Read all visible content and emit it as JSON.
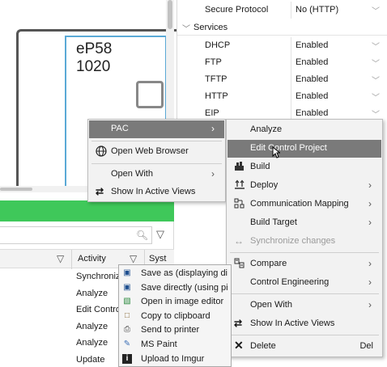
{
  "device": {
    "name": "eP58\n1020"
  },
  "properties": {
    "secure_protocol": {
      "label": "Secure Protocol",
      "value": "No (HTTP)"
    },
    "services_label": "Services",
    "services": [
      {
        "label": "DHCP",
        "value": "Enabled"
      },
      {
        "label": "FTP",
        "value": "Enabled"
      },
      {
        "label": "TFTP",
        "value": "Enabled"
      },
      {
        "label": "HTTP",
        "value": "Enabled"
      },
      {
        "label": "EIP",
        "value": "Enabled"
      }
    ]
  },
  "list": {
    "activity_header": "Activity",
    "system_header": "Syst",
    "activities": [
      "Synchroniz",
      "Analyze",
      "Edit Contro",
      "Analyze",
      "Analyze",
      "Update"
    ]
  },
  "pac_menu": {
    "items": [
      {
        "label": "PAC",
        "submenu": true,
        "highlighted": true
      },
      {
        "label": "Open Web Browser",
        "icon": "globe-icon"
      },
      {
        "label": "Open With",
        "submenu": true
      },
      {
        "label": "Show In Active Views",
        "icon": "swap-arrows-icon"
      }
    ]
  },
  "sub_menu": {
    "items": [
      {
        "label": "Analyze"
      },
      {
        "label": "Edit Control Project",
        "highlighted": true
      },
      {
        "label": "Build",
        "icon": "build-icon"
      },
      {
        "label": "Deploy",
        "icon": "deploy-icon",
        "submenu": true
      },
      {
        "label": "Communication Mapping",
        "icon": "network-icon",
        "submenu": true
      },
      {
        "label": "Build Target",
        "submenu": true
      },
      {
        "label": "Synchronize changes",
        "icon": "sync-icon",
        "disabled": true
      },
      {
        "label": "Compare",
        "icon": "compare-icon",
        "submenu": true
      },
      {
        "label": "Control Engineering",
        "submenu": true
      },
      {
        "label": "Open With",
        "submenu": true
      },
      {
        "label": "Show In Active Views",
        "icon": "swap-arrows-icon"
      },
      {
        "label": "Delete",
        "icon": "delete-x-icon",
        "shortcut": "Del"
      }
    ]
  },
  "screenshot_menu": {
    "items": [
      {
        "label": "Save as (displaying di",
        "icon": "floppy-icon"
      },
      {
        "label": "Save directly (using pi",
        "icon": "floppy-icon"
      },
      {
        "label": "Open in image editor",
        "icon": "image-editor-icon"
      },
      {
        "label": "Copy to clipboard",
        "icon": "clipboard-icon"
      },
      {
        "label": "Send to printer",
        "icon": "printer-icon"
      },
      {
        "label": "MS Paint",
        "icon": "paint-icon"
      },
      {
        "label": "Upload to Imgur",
        "icon": "imgur-icon"
      }
    ]
  },
  "colors": {
    "accent_green": "#3fc85a",
    "highlight": "#7a7a7a",
    "device_border": "#5aa9d6"
  }
}
